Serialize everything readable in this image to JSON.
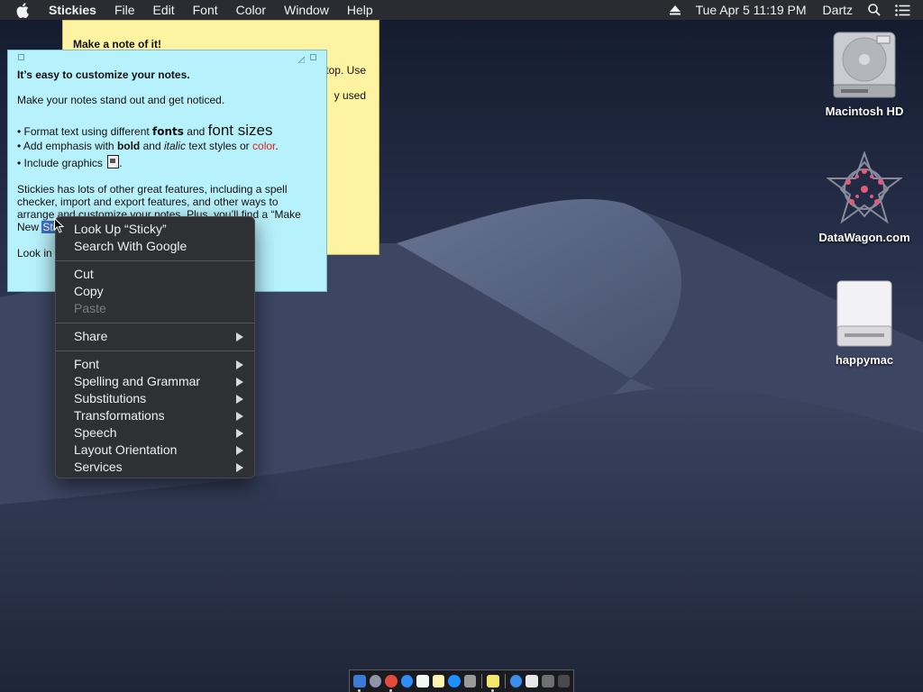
{
  "menubar": {
    "app_name": "Stickies",
    "menus": [
      "File",
      "Edit",
      "Font",
      "Color",
      "Window",
      "Help"
    ],
    "clock": "Tue Apr 5  11:19 PM",
    "user": "Dartz"
  },
  "yellow_note": {
    "title": "Make a note of it!",
    "fragment_1": "top. Use",
    "fragment_2": "y used"
  },
  "blue_note": {
    "heading": "It’s easy to customize your notes.",
    "intro": "Make your notes stand out and get noticed.",
    "bullet1_prefix": "• Format text using different ",
    "bullet1_fonts": "fonts",
    "bullet1_and": " and ",
    "bullet1_sizes": "font sizes",
    "bullet2_prefix": "• Add emphasis with ",
    "bullet2_bold": "bold",
    "bullet2_and": " and ",
    "bullet2_italic": "italic",
    "bullet2_mid": " text styles or ",
    "bullet2_color": "color",
    "bullet2_end": ".",
    "bullet3_prefix": "• Include graphics ",
    "bullet3_end": ".",
    "para_line1": "Stickies has lots of other great features, including a spell",
    "para_line2": "checker, import and export features, and other ways to",
    "para_line3": "arrange and customize your notes. Plus, you’ll find a “Make",
    "para_line4_prefix": "New ",
    "para_line4_selected": "Sti",
    "footer_prefix": "Look in"
  },
  "context_menu": {
    "items": [
      {
        "label": "Look Up “Sticky”",
        "submenu": false,
        "enabled": true
      },
      {
        "label": "Search With Google",
        "submenu": false,
        "enabled": true
      },
      {
        "label": "Cut",
        "submenu": false,
        "enabled": true
      },
      {
        "label": "Copy",
        "submenu": false,
        "enabled": true
      },
      {
        "label": "Paste",
        "submenu": false,
        "enabled": false
      },
      {
        "label": "Share",
        "submenu": true,
        "enabled": true
      },
      {
        "label": "Font",
        "submenu": true,
        "enabled": true
      },
      {
        "label": "Spelling and Grammar",
        "submenu": true,
        "enabled": true
      },
      {
        "label": "Substitutions",
        "submenu": true,
        "enabled": true
      },
      {
        "label": "Transformations",
        "submenu": true,
        "enabled": true
      },
      {
        "label": "Speech",
        "submenu": true,
        "enabled": true
      },
      {
        "label": "Layout Orientation",
        "submenu": true,
        "enabled": true
      },
      {
        "label": "Services",
        "submenu": true,
        "enabled": true
      }
    ]
  },
  "desktop_icons": [
    {
      "label": "Macintosh HD",
      "icon": "hard-drive-icon"
    },
    {
      "label": "DataWagon.com",
      "icon": "network-server-icon"
    },
    {
      "label": "happymac",
      "icon": "external-drive-icon"
    }
  ],
  "colors": {
    "menubar_bg": "#2b2c31",
    "yellow_note_bg": "#fdf3a0",
    "blue_note_bg": "#b7f1fb",
    "menu_bg": "#2f3034",
    "selection": "#3b6fbf",
    "emphasis_red": "#e0201c"
  }
}
